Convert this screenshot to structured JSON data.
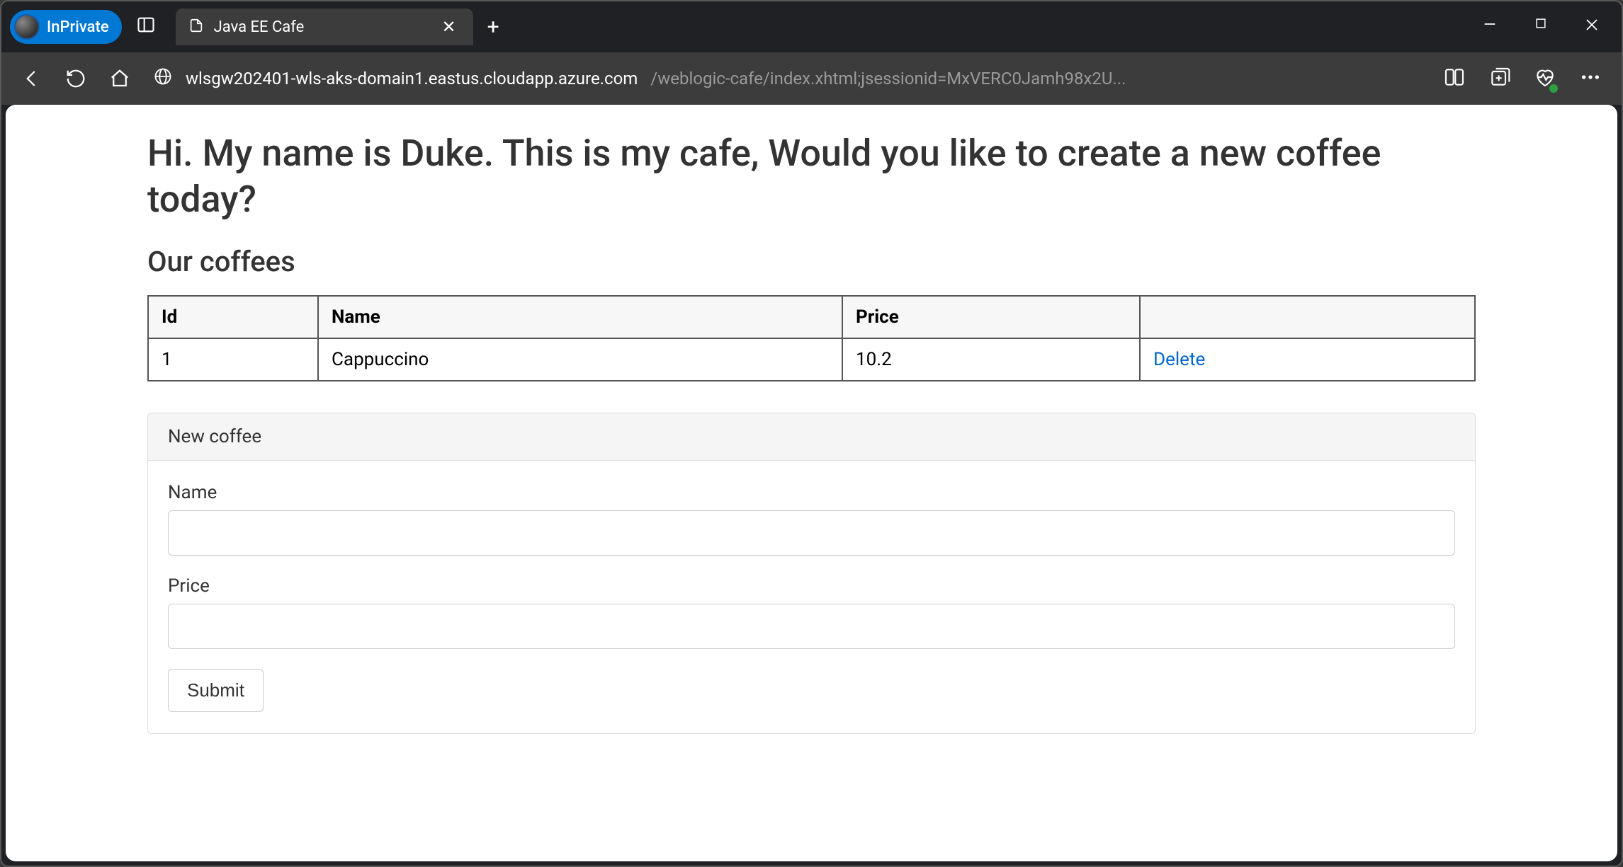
{
  "browser": {
    "inprivate_label": "InPrivate",
    "tab_title": "Java EE Cafe",
    "url_host": "wlsgw202401-wls-aks-domain1.eastus.cloudapp.azure.com",
    "url_path": "/weblogic-cafe/index.xhtml;jsessionid=MxVERC0Jamh98x2U..."
  },
  "page": {
    "heading": "Hi. My name is Duke. This is my cafe, Would you like to create a new coffee today?",
    "subheading": "Our coffees",
    "table": {
      "headers": {
        "id": "Id",
        "name": "Name",
        "price": "Price",
        "action": ""
      },
      "rows": [
        {
          "id": "1",
          "name": "Cappuccino",
          "price": "10.2",
          "action": "Delete"
        }
      ]
    },
    "form": {
      "panel_title": "New coffee",
      "name_label": "Name",
      "name_value": "",
      "price_label": "Price",
      "price_value": "",
      "submit_label": "Submit"
    }
  }
}
